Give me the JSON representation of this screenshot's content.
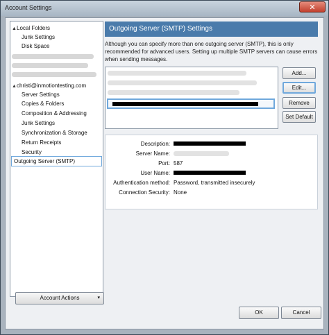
{
  "window": {
    "title": "Account Settings",
    "close_glyph": "✕"
  },
  "tree": {
    "local_folders": "Local Folders",
    "junk_settings_1": "Junk Settings",
    "disk_space": "Disk Space",
    "account": "christi@inmotiontesting.com",
    "server_settings": "Server Settings",
    "copies_folders": "Copies & Folders",
    "composition": "Composition & Addressing",
    "junk_settings_2": "Junk Settings",
    "sync_storage": "Synchronization & Storage",
    "return_receipts": "Return Receipts",
    "security": "Security",
    "outgoing_server": "Outgoing Server (SMTP)",
    "expanded_glyph": "▲"
  },
  "account_actions": {
    "label": "Account Actions",
    "caret": "▾"
  },
  "header": {
    "title": "Outgoing Server (SMTP) Settings"
  },
  "description": "Although you can specify more than one outgoing server (SMTP), this is only recommended for advanced users. Setting up multiple SMTP servers can cause errors when sending messages.",
  "buttons": {
    "add": "Add...",
    "edit": "Edit...",
    "remove": "Remove",
    "set_default": "Set Default",
    "ok": "OK",
    "cancel": "Cancel"
  },
  "details": {
    "description_label": "Description:",
    "server_name_label": "Server Name:",
    "port_label": "Port:",
    "port_value": "587",
    "user_name_label": "User Name:",
    "auth_label": "Authentication method:",
    "auth_value": "Password, transmitted insecurely",
    "connsec_label": "Connection Security:",
    "connsec_value": "None"
  },
  "colors": {
    "header_bg": "#4a7bab",
    "highlight": "#6fa8dc"
  }
}
